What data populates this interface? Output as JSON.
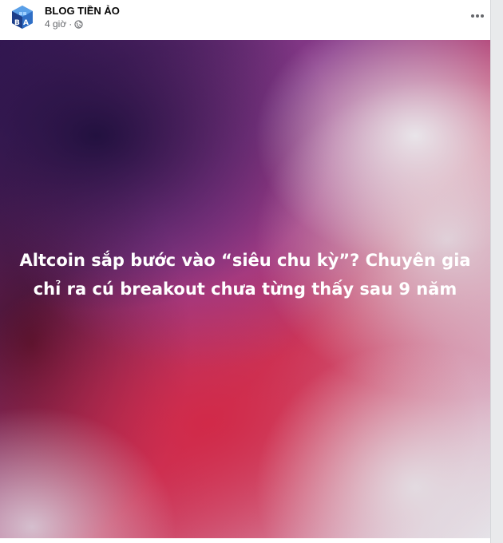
{
  "post": {
    "page_name": "BLOG TIỀN ẢO",
    "time": "4 giờ",
    "separator": "·",
    "privacy_icon": "globe-icon",
    "more_icon": "more-options-icon",
    "headline": "Altcoin sắp bước vào “siêu chu kỳ”? Chuyên gia chỉ ra cú breakout chưa từng thấy sau 9 năm"
  },
  "colors": {
    "avatar_blue": "#2f6fc6",
    "avatar_dark": "#1d3f8a",
    "meta_gray": "#65676b",
    "headline_text": "#ffffff"
  }
}
